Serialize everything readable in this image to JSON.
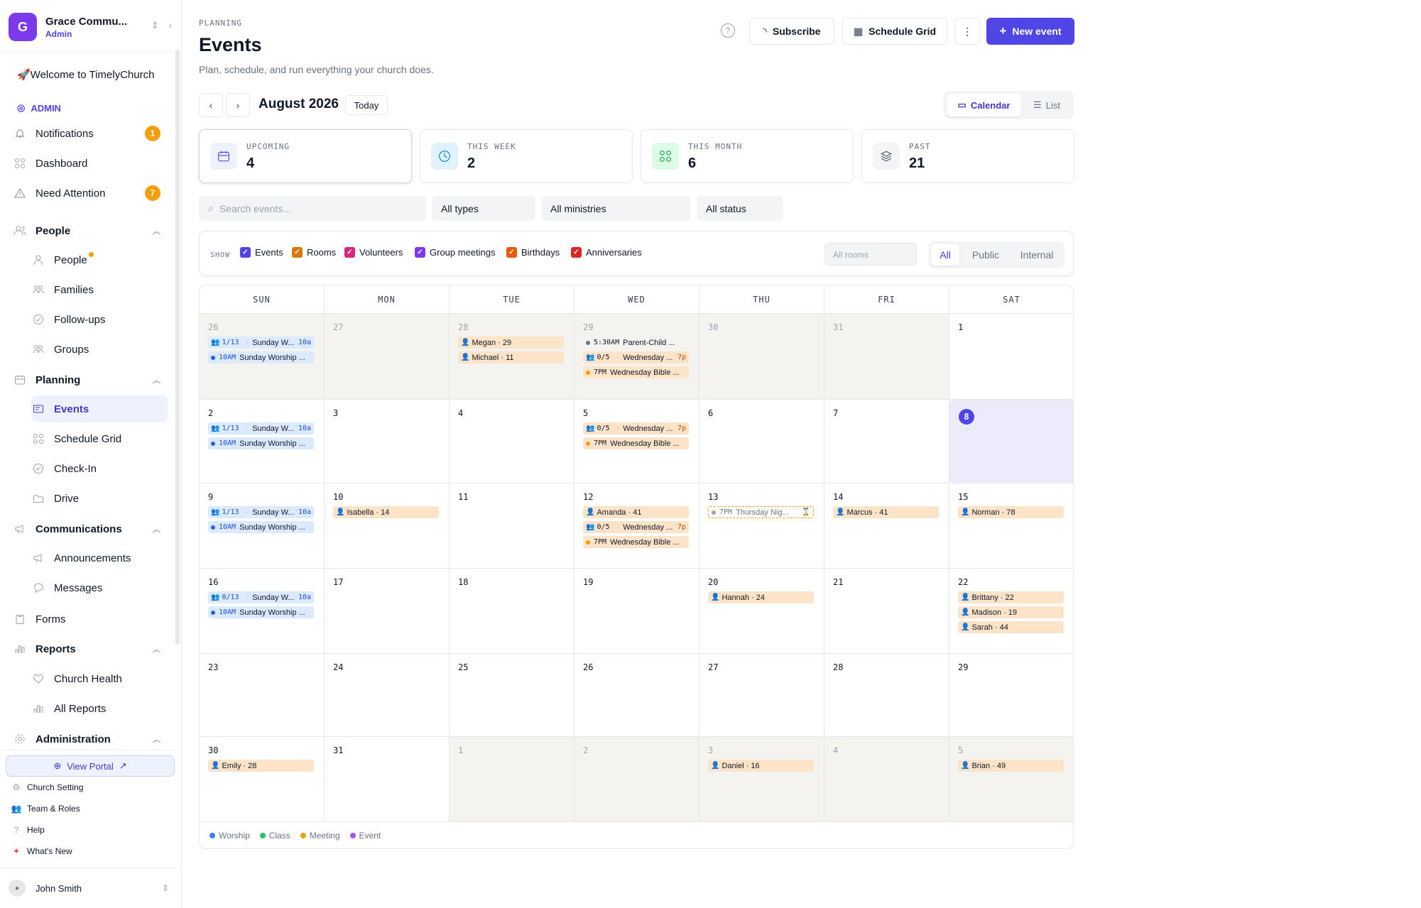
{
  "org": {
    "initial": "G",
    "name": "Grace Commu...",
    "role": "Admin"
  },
  "sidebar": {
    "welcome": "🚀Welcome to TimelyChurch",
    "admin_label": "ADMIN",
    "notifications": {
      "label": "Notifications",
      "badge": "1"
    },
    "dashboard": "Dashboard",
    "need_attention": {
      "label": "Need Attention",
      "badge": "7"
    },
    "people_section": "People",
    "people": "People",
    "families": "Families",
    "followups": "Follow-ups",
    "groups": "Groups",
    "planning_section": "Planning",
    "events": "Events",
    "schedule_grid": "Schedule Grid",
    "checkin": "Check-In",
    "drive": "Drive",
    "communications_section": "Communications",
    "announcements": "Announcements",
    "messages": "Messages",
    "forms": "Forms",
    "reports_section": "Reports",
    "church_health": "Church Health",
    "all_reports": "All Reports",
    "administration_section": "Administration",
    "view_portal": "View Portal",
    "church_setting": "Church Setting",
    "team_roles": "Team & Roles",
    "help": "Help",
    "whats_new": "What's New",
    "user": "John Smith"
  },
  "header": {
    "eyebrow": "PLANNING",
    "title": "Events",
    "subtitle": "Plan, schedule, and run everything your church does.",
    "subscribe": "Subscribe",
    "schedule_grid": "Schedule Grid",
    "new_event": "New event"
  },
  "toolbar": {
    "month": "August 2026",
    "today": "Today",
    "calendar": "Calendar",
    "list": "List"
  },
  "stats": [
    {
      "label": "UPCOMING",
      "value": "4"
    },
    {
      "label": "THIS WEEK",
      "value": "2"
    },
    {
      "label": "THIS MONTH",
      "value": "6"
    },
    {
      "label": "PAST",
      "value": "21"
    }
  ],
  "filters": {
    "search_placeholder": "Search events...",
    "types": "All types",
    "ministries": "All ministries",
    "status": "All status"
  },
  "show": {
    "label": "SHOW",
    "events": "Events",
    "rooms": "Rooms",
    "volunteers": "Volunteers",
    "group_meetings": "Group meetings",
    "birthdays": "Birthdays",
    "anniversaries": "Anniversaries",
    "rooms_select": "All rooms",
    "all": "All",
    "public": "Public",
    "internal": "Internal"
  },
  "weekdays": [
    "SUN",
    "MON",
    "TUE",
    "WED",
    "THU",
    "FRI",
    "SAT"
  ],
  "weeks": [
    [
      {
        "d": "26",
        "out": true,
        "chips": [
          {
            "k": "blue",
            "ppl": true,
            "t": "1/13",
            "txt": "Sunday W...",
            "rt": "10a"
          },
          {
            "k": "blue",
            "dot": "#2563eb",
            "t": "10AM",
            "txt": "Sunday Worship ..."
          }
        ]
      },
      {
        "d": "27",
        "out": true,
        "chips": []
      },
      {
        "d": "28",
        "out": true,
        "chips": [
          {
            "k": "orange",
            "person": true,
            "txt": "Megan · 29"
          },
          {
            "k": "orange",
            "person": true,
            "txt": "Michael · 11"
          }
        ]
      },
      {
        "d": "29",
        "out": true,
        "chips": [
          {
            "k": "plain",
            "dot": "#6b7280",
            "t": "5:30AM",
            "txt": "Parent-Child ..."
          },
          {
            "k": "orange",
            "ppl": true,
            "t": "0/5",
            "txt": "Wednesday ...",
            "rt": "7p"
          },
          {
            "k": "orange",
            "dot": "#f59e0b",
            "t": "7PM",
            "txt": "Wednesday Bible ..."
          }
        ]
      },
      {
        "d": "30",
        "out": true,
        "chips": []
      },
      {
        "d": "31",
        "out": true,
        "chips": []
      },
      {
        "d": "1",
        "chips": []
      }
    ],
    [
      {
        "d": "2",
        "chips": [
          {
            "k": "blue",
            "ppl": true,
            "t": "1/13",
            "txt": "Sunday W...",
            "rt": "10a"
          },
          {
            "k": "blue",
            "dot": "#2563eb",
            "t": "10AM",
            "txt": "Sunday Worship ..."
          }
        ]
      },
      {
        "d": "3",
        "chips": []
      },
      {
        "d": "4",
        "chips": []
      },
      {
        "d": "5",
        "chips": [
          {
            "k": "orange",
            "ppl": true,
            "t": "0/5",
            "txt": "Wednesday ...",
            "rt": "7p"
          },
          {
            "k": "orange",
            "dot": "#f59e0b",
            "t": "7PM",
            "txt": "Wednesday Bible ..."
          }
        ]
      },
      {
        "d": "6",
        "chips": []
      },
      {
        "d": "7",
        "chips": []
      },
      {
        "d": "8",
        "today": true,
        "chips": []
      }
    ],
    [
      {
        "d": "9",
        "chips": [
          {
            "k": "blue",
            "ppl": true,
            "t": "1/13",
            "txt": "Sunday W...",
            "rt": "10a"
          },
          {
            "k": "blue",
            "dot": "#2563eb",
            "t": "10AM",
            "txt": "Sunday Worship ..."
          }
        ]
      },
      {
        "d": "10",
        "chips": [
          {
            "k": "orange",
            "person": true,
            "txt": "Isabella · 14"
          }
        ]
      },
      {
        "d": "11",
        "chips": []
      },
      {
        "d": "12",
        "chips": [
          {
            "k": "orange",
            "person": true,
            "txt": "Amanda · 41"
          },
          {
            "k": "orange",
            "ppl": true,
            "t": "0/5",
            "txt": "Wednesday ...",
            "rt": "7p"
          },
          {
            "k": "orange",
            "dot": "#f59e0b",
            "t": "7PM",
            "txt": "Wednesday Bible ..."
          }
        ]
      },
      {
        "d": "13",
        "chips": [
          {
            "k": "dash",
            "dot": "#9ca3af",
            "t": "7PM",
            "txt": "Thursday Nig...",
            "rt": "⌛"
          }
        ]
      },
      {
        "d": "14",
        "chips": [
          {
            "k": "orange",
            "person": true,
            "txt": "Marcus · 41"
          }
        ]
      },
      {
        "d": "15",
        "chips": [
          {
            "k": "orange",
            "person": true,
            "txt": "Norman · 78"
          }
        ]
      }
    ],
    [
      {
        "d": "16",
        "chips": [
          {
            "k": "blue",
            "ppl": true,
            "t": "0/13",
            "txt": "Sunday W...",
            "rt": "10a"
          },
          {
            "k": "blue",
            "dot": "#2563eb",
            "t": "10AM",
            "txt": "Sunday Worship ..."
          }
        ]
      },
      {
        "d": "17",
        "chips": []
      },
      {
        "d": "18",
        "chips": []
      },
      {
        "d": "19",
        "chips": []
      },
      {
        "d": "20",
        "chips": [
          {
            "k": "orange",
            "person": true,
            "txt": "Hannah · 24"
          }
        ]
      },
      {
        "d": "21",
        "chips": []
      },
      {
        "d": "22",
        "chips": [
          {
            "k": "orange",
            "person": true,
            "txt": "Brittany · 22"
          },
          {
            "k": "orange",
            "person": true,
            "txt": "Madison · 19"
          },
          {
            "k": "orange",
            "person": true,
            "txt": "Sarah · 44"
          }
        ]
      }
    ],
    [
      {
        "d": "23",
        "chips": []
      },
      {
        "d": "24",
        "chips": []
      },
      {
        "d": "25",
        "chips": []
      },
      {
        "d": "26",
        "chips": []
      },
      {
        "d": "27",
        "chips": []
      },
      {
        "d": "28",
        "chips": []
      },
      {
        "d": "29",
        "chips": []
      }
    ],
    [
      {
        "d": "30",
        "chips": [
          {
            "k": "orange",
            "person": true,
            "txt": "Emily · 28"
          }
        ]
      },
      {
        "d": "31",
        "chips": []
      },
      {
        "d": "1",
        "out": true,
        "chips": []
      },
      {
        "d": "2",
        "out": true,
        "chips": []
      },
      {
        "d": "3",
        "out": true,
        "chips": [
          {
            "k": "orange",
            "person": true,
            "txt": "Daniel · 16"
          }
        ]
      },
      {
        "d": "4",
        "out": true,
        "chips": []
      },
      {
        "d": "5",
        "out": true,
        "chips": [
          {
            "k": "orange",
            "person": true,
            "txt": "Brian · 49"
          }
        ]
      }
    ]
  ],
  "legend": [
    {
      "label": "Worship",
      "color": "#3b82f6"
    },
    {
      "label": "Class",
      "color": "#22c55e"
    },
    {
      "label": "Meeting",
      "color": "#f59e0b"
    },
    {
      "label": "Event",
      "color": "#a855f7"
    }
  ]
}
